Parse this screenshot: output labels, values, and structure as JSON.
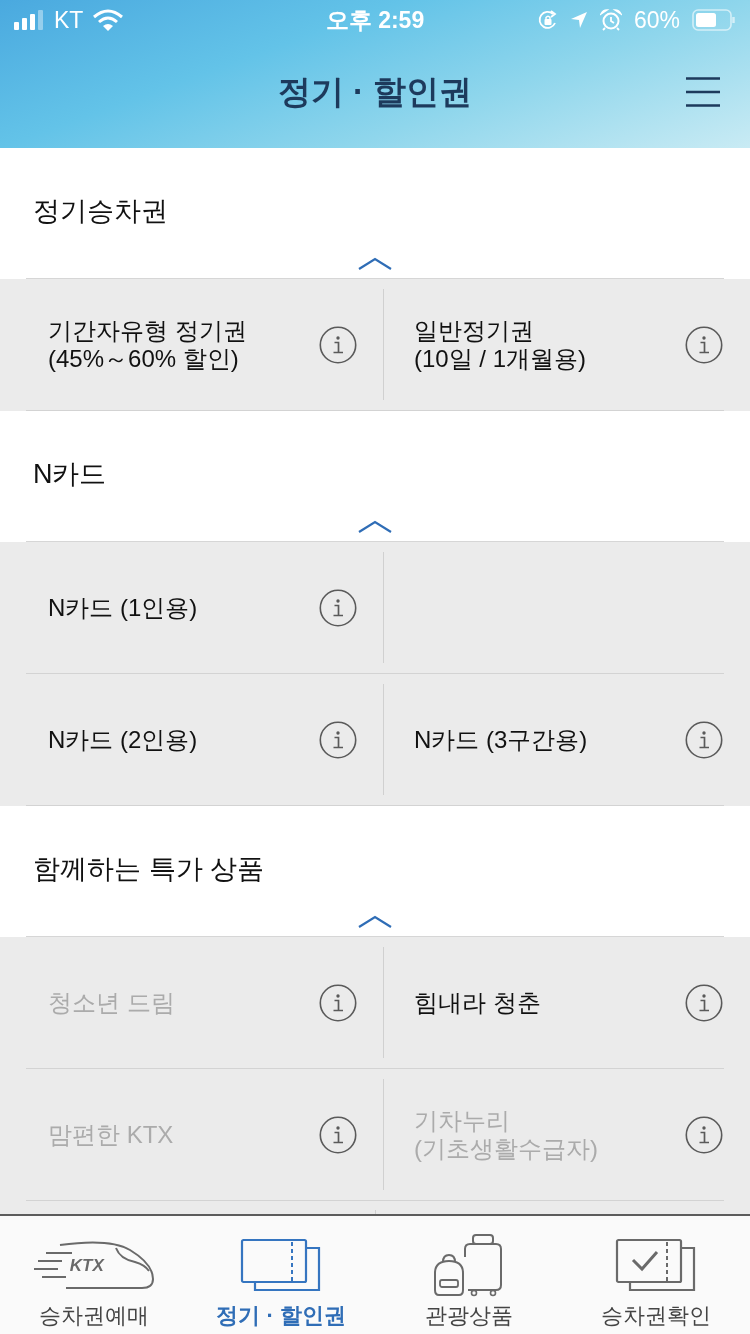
{
  "status_bar": {
    "carrier": "KT",
    "time": "오후 2:59",
    "battery_percent": "60%"
  },
  "header": {
    "title": "정기 · 할인권"
  },
  "sections": [
    {
      "title": "정기승차권",
      "expanded": true,
      "rows": [
        [
          {
            "label": "기간자유형 정기권\n(45%～60% 할인)",
            "disabled": false
          },
          {
            "label": "일반정기권\n(10일 / 1개월용)",
            "disabled": false
          }
        ]
      ]
    },
    {
      "title": "N카드",
      "expanded": true,
      "rows": [
        [
          {
            "label": "N카드 (1인용)",
            "disabled": false
          }
        ],
        [
          {
            "label": "N카드 (2인용)",
            "disabled": false
          },
          {
            "label": "N카드 (3구간용)",
            "disabled": false
          }
        ]
      ]
    },
    {
      "title": "함께하는 특가 상품",
      "expanded": true,
      "rows": [
        [
          {
            "label": "청소년 드림",
            "disabled": true
          },
          {
            "label": "힘내라 청춘",
            "disabled": false
          }
        ],
        [
          {
            "label": "맘편한 KTX",
            "disabled": true
          },
          {
            "label": "기차누리\n(기초생활수급자)",
            "disabled": true
          }
        ]
      ]
    }
  ],
  "tab_bar": {
    "tabs": [
      {
        "kind": "train",
        "icon_text": "KTX",
        "label": "승차권예매",
        "selected": false
      },
      {
        "kind": "tickets",
        "label": "정기 · 할인권",
        "selected": true
      },
      {
        "kind": "luggage",
        "label": "관광상품",
        "selected": false
      },
      {
        "kind": "checked-ticket",
        "label": "승차권확인",
        "selected": false
      }
    ]
  }
}
